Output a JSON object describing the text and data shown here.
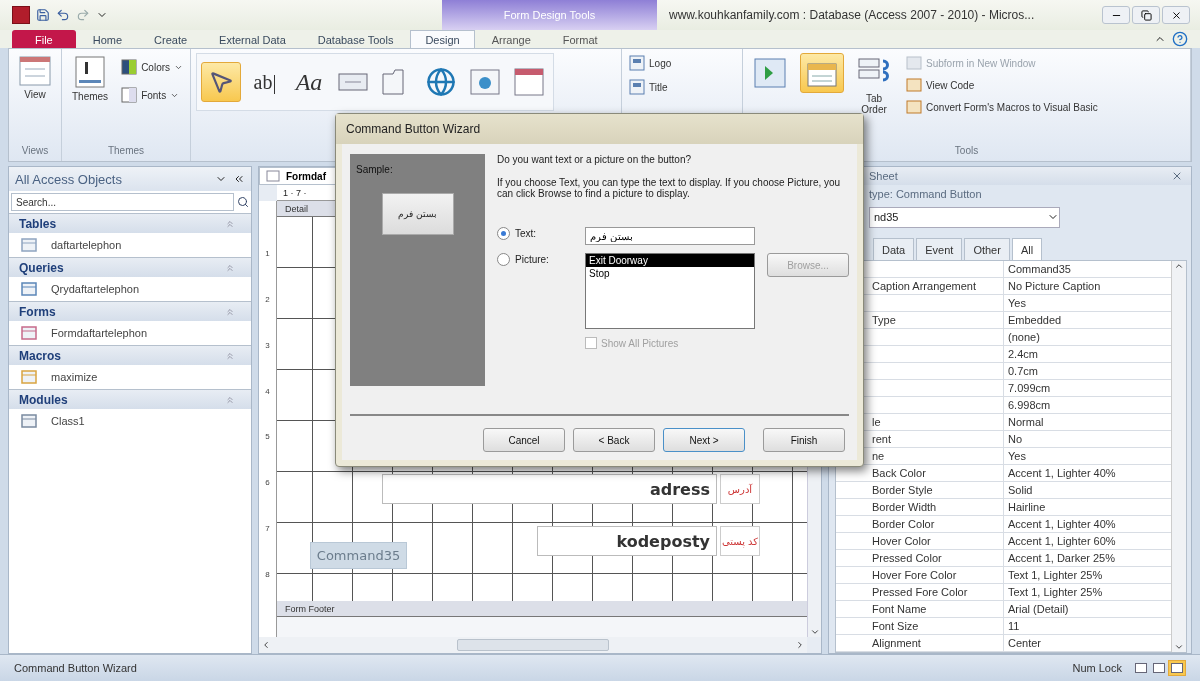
{
  "window": {
    "title": "www.kouhkanfamily.com : Database (Access 2007 - 2010) - Micros...",
    "context_tab_group": "Form Design Tools"
  },
  "ribbon_tabs": [
    {
      "label": "File",
      "kind": "file",
      "selected": false
    },
    {
      "label": "Home",
      "kind": "normal",
      "selected": false
    },
    {
      "label": "Create",
      "kind": "normal",
      "selected": false
    },
    {
      "label": "External Data",
      "kind": "normal",
      "selected": false
    },
    {
      "label": "Database Tools",
      "kind": "normal",
      "selected": false
    },
    {
      "label": "Design",
      "kind": "contextual",
      "selected": true
    },
    {
      "label": "Arrange",
      "kind": "contextual",
      "selected": false
    },
    {
      "label": "Format",
      "kind": "contextual",
      "selected": false
    }
  ],
  "ribbon": {
    "views": {
      "group_label": "Views",
      "button": "View"
    },
    "themes": {
      "group_label": "Themes",
      "button": "Themes",
      "items": [
        "Colors",
        "Fonts"
      ]
    },
    "controls": [
      {
        "kind": "select",
        "selected": true
      },
      {
        "kind": "textbox",
        "glyph": "ab|",
        "selected": false
      },
      {
        "kind": "label",
        "glyph": "Aa",
        "selected": false
      },
      {
        "kind": "button",
        "selected": false
      },
      {
        "kind": "tab",
        "selected": false
      },
      {
        "kind": "hyperlink",
        "selected": false
      },
      {
        "kind": "web",
        "selected": false
      },
      {
        "kind": "navigation",
        "selected": false
      }
    ],
    "header_footer": [
      "Logo",
      "Title"
    ],
    "tools": {
      "group_label": "Tools",
      "large": [
        {
          "kind": "add_fields",
          "selected": false
        },
        {
          "kind": "property_sheet",
          "selected": true
        },
        {
          "kind": "tab_order",
          "label": "Tab Order",
          "selected": false
        }
      ],
      "small": [
        {
          "label": "Subform in New Window",
          "disabled": true
        },
        {
          "label": "View Code",
          "disabled": false
        },
        {
          "label": "Convert Form's Macros to Visual Basic",
          "disabled": false
        }
      ]
    }
  },
  "navigation_pane": {
    "title": "All Access Objects",
    "search_placeholder": "Search...",
    "groups": [
      {
        "label": "Tables",
        "kind": "table",
        "items": [
          "daftartelephon"
        ]
      },
      {
        "label": "Queries",
        "kind": "query",
        "items": [
          "Qrydaftartelephon"
        ]
      },
      {
        "label": "Forms",
        "kind": "form",
        "items": [
          "Formdaftartelephon"
        ]
      },
      {
        "label": "Macros",
        "kind": "macro",
        "items": [
          "maximize"
        ]
      },
      {
        "label": "Modules",
        "kind": "module",
        "items": [
          "Class1"
        ]
      }
    ]
  },
  "form_designer": {
    "tab": "Formdaf",
    "ruler_text": "1 · 7 ·",
    "vertical_ruler": [
      "1",
      "2",
      "3",
      "4",
      "5",
      "6",
      "7",
      "8"
    ],
    "sections": [
      "Detail",
      "Form Footer"
    ],
    "controls": [
      {
        "kind": "textbox",
        "text": "adress"
      },
      {
        "kind": "label",
        "text": "آدرس"
      },
      {
        "kind": "textbox",
        "text": "kodeposty"
      },
      {
        "kind": "label",
        "text": "کد پستی"
      },
      {
        "kind": "button",
        "text": "Command35"
      }
    ]
  },
  "wizard": {
    "title": "Command Button Wizard",
    "sample_label": "Sample:",
    "sample_button": "بستن فرم",
    "question": "Do you want text or a picture on the button?",
    "help": "If you choose Text, you can type the text to display.  If you choose Picture, you can click Browse to find a picture to display.",
    "options": [
      {
        "kind": "text",
        "label": "Text:",
        "selected": true,
        "value": "بستن فرم"
      },
      {
        "kind": "picture",
        "label": "Picture:",
        "selected": false,
        "list": [
          {
            "label": "Exit Doorway",
            "selected": true
          },
          {
            "label": "Stop",
            "selected": false
          }
        ]
      }
    ],
    "browse": {
      "label": "Browse...",
      "disabled": true
    },
    "show_all": {
      "label": "Show All Pictures",
      "checked": false,
      "disabled": true
    },
    "buttons": [
      {
        "label": "Cancel",
        "default": false
      },
      {
        "label": "< Back",
        "default": false
      },
      {
        "label": "Next >",
        "default": true
      },
      {
        "label": "Finish",
        "default": false
      }
    ]
  },
  "property_sheet": {
    "title": "Sheet",
    "selection_type": "type:  Command Button",
    "selector": "nd35",
    "tabs": [
      {
        "label": "Data",
        "selected": false
      },
      {
        "label": "Event",
        "selected": false
      },
      {
        "label": "Other",
        "selected": false
      },
      {
        "label": "All",
        "selected": true
      }
    ],
    "rows": [
      {
        "value": "Command35"
      },
      {
        "name": "Caption Arrangement",
        "value": "No Picture Caption"
      },
      {
        "value": "Yes"
      },
      {
        "name": "Type",
        "value": "Embedded"
      },
      {
        "value": "(none)"
      },
      {
        "value": "2.4cm"
      },
      {
        "value": "0.7cm"
      },
      {
        "value": "7.099cm"
      },
      {
        "value": "6.998cm"
      },
      {
        "name": "le",
        "value": "Normal"
      },
      {
        "name": "rent",
        "value": "No"
      },
      {
        "name": "ne",
        "value": "Yes"
      },
      {
        "name": "Back Color",
        "value": "Accent 1, Lighter 40%"
      },
      {
        "name": "Border Style",
        "value": "Solid"
      },
      {
        "name": "Border Width",
        "value": "Hairline"
      },
      {
        "name": "Border Color",
        "value": "Accent 1, Lighter 40%"
      },
      {
        "name": "Hover Color",
        "value": "Accent 1, Lighter 60%"
      },
      {
        "name": "Pressed Color",
        "value": "Accent 1, Darker 25%"
      },
      {
        "name": "Hover Fore Color",
        "value": "Text 1, Lighter 25%"
      },
      {
        "name": "Pressed Fore Color",
        "value": "Text 1, Lighter 25%"
      },
      {
        "name": "Font Name",
        "value": "Arial (Detail)"
      },
      {
        "name": "Font Size",
        "value": "11"
      },
      {
        "name": "Alignment",
        "value": "Center"
      }
    ]
  },
  "status_bar": {
    "text": "Command Button Wizard",
    "indicators": [
      "Num Lock"
    ],
    "views": [
      {
        "selected": false
      },
      {
        "selected": false
      },
      {
        "selected": true
      }
    ]
  }
}
